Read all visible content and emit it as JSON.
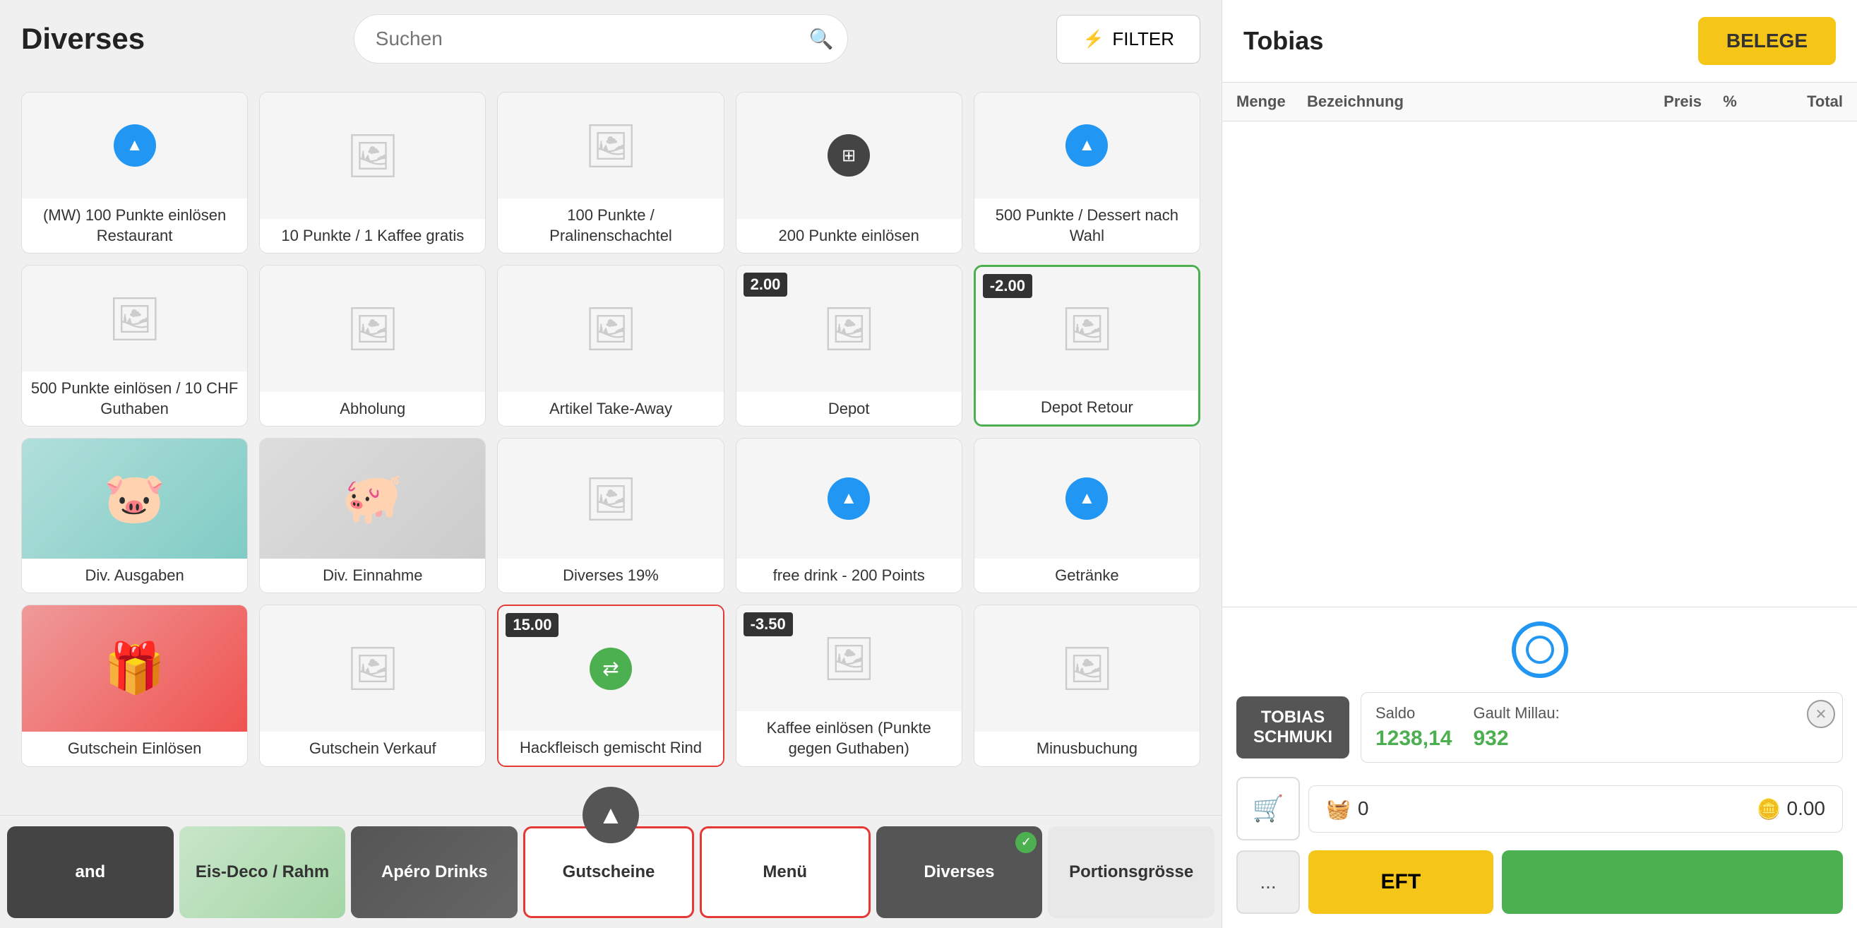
{
  "header": {
    "title": "Diverses",
    "search_placeholder": "Suchen",
    "filter_label": "FILTER"
  },
  "products": [
    {
      "id": 1,
      "label": "(MW) 100 Punkte einlösen Restaurant",
      "icon": "blue-circle",
      "price_badge": null,
      "border": "normal"
    },
    {
      "id": 2,
      "label": "10 Punkte / 1 Kaffee gratis",
      "icon": "placeholder",
      "price_badge": null,
      "border": "normal"
    },
    {
      "id": 3,
      "label": "100 Punkte / Pralinenschachtel",
      "icon": "placeholder",
      "price_badge": null,
      "border": "normal"
    },
    {
      "id": 4,
      "label": "200 Punkte einlösen",
      "icon": "dark-circle",
      "price_badge": null,
      "border": "normal"
    },
    {
      "id": 5,
      "label": "500 Punkte / Dessert nach Wahl",
      "icon": "blue-circle",
      "price_badge": null,
      "border": "normal"
    },
    {
      "id": 6,
      "label": "500 Punkte einlösen / 10 CHF Guthaben",
      "icon": "placeholder",
      "price_badge": null,
      "border": "normal"
    },
    {
      "id": 7,
      "label": "Abholung",
      "icon": "placeholder",
      "price_badge": null,
      "border": "normal"
    },
    {
      "id": 8,
      "label": "Artikel Take-Away",
      "icon": "placeholder",
      "price_badge": null,
      "border": "normal"
    },
    {
      "id": 9,
      "label": "Depot",
      "icon": "placeholder",
      "price_badge": "2.00",
      "border": "normal"
    },
    {
      "id": 10,
      "label": "Depot Retour",
      "icon": "placeholder",
      "price_badge": "-2.00",
      "border": "green"
    },
    {
      "id": 11,
      "label": "Div. Ausgaben",
      "icon": "piggy-bandage",
      "price_badge": null,
      "border": "normal"
    },
    {
      "id": 12,
      "label": "Div. Einnahme",
      "icon": "piggy-gray",
      "price_badge": null,
      "border": "normal"
    },
    {
      "id": 13,
      "label": "Diverses 19%",
      "icon": "placeholder",
      "price_badge": null,
      "border": "normal"
    },
    {
      "id": 14,
      "label": "free drink - 200 Points",
      "icon": "blue-circle",
      "price_badge": null,
      "border": "normal"
    },
    {
      "id": 15,
      "label": "Getränke",
      "icon": "blue-circle",
      "price_badge": null,
      "border": "normal"
    },
    {
      "id": 16,
      "label": "Gutschein Einlösen",
      "icon": "gift-red",
      "price_badge": null,
      "border": "normal"
    },
    {
      "id": 17,
      "label": "Gutschein Verkauf",
      "icon": "placeholder",
      "price_badge": null,
      "border": "normal"
    },
    {
      "id": 18,
      "label": "Hackfleisch gemischt Rind",
      "icon": "green-circle",
      "price_badge": "15.00",
      "border": "red"
    },
    {
      "id": 19,
      "label": "Kaffee einlösen (Punkte gegen Guthaben)",
      "icon": "placeholder",
      "price_badge": "-3.50",
      "border": "normal"
    },
    {
      "id": 20,
      "label": "Minusbuchung",
      "icon": "placeholder",
      "price_badge": null,
      "border": "normal"
    }
  ],
  "bottom_nav": [
    {
      "id": "and",
      "label": "and",
      "type": "text-dark"
    },
    {
      "id": "eis",
      "label": "Eis-Deco / Rahm",
      "type": "image"
    },
    {
      "id": "apero",
      "label": "Apéro Drinks",
      "type": "image"
    },
    {
      "id": "gutscheine",
      "label": "Gutscheine",
      "type": "default-red"
    },
    {
      "id": "menu",
      "label": "Menü",
      "type": "default-red"
    },
    {
      "id": "diverses",
      "label": "Diverses",
      "type": "active-dark"
    },
    {
      "id": "portionsgroesse",
      "label": "Portionsgrösse",
      "type": "default"
    }
  ],
  "right_panel": {
    "customer_name": "Tobias",
    "belege_label": "BELEGE",
    "table_headers": {
      "menge": "Menge",
      "bezeichnung": "Bezeichnung",
      "preis": "Preis",
      "pct": "%",
      "total": "Total"
    },
    "customer_badge": {
      "line1": "TOBIAS",
      "line2": "SCHMUKI"
    },
    "saldo_label": "Saldo",
    "saldo_value": "1238,14",
    "gaultmillau_label": "Gault Millau:",
    "gaultmillau_value": "932",
    "basket_count": "0",
    "basket_amount": "0.00",
    "eft_label": "EFT",
    "more_label": "...",
    "pay_label": ""
  }
}
